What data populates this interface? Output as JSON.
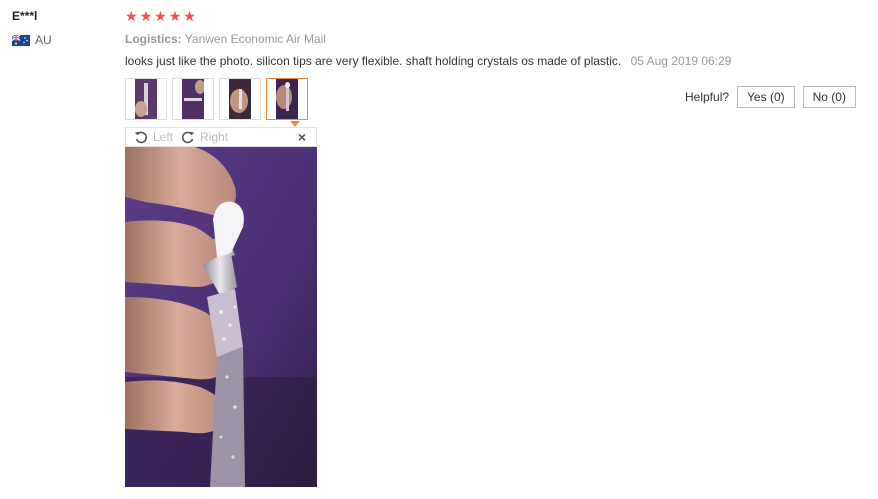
{
  "reviewer": {
    "name": "E***l",
    "country_code": "AU",
    "flag_icon": "australia-flag-icon"
  },
  "rating": {
    "stars": 5,
    "max": 5,
    "star_color": "#f44e4e"
  },
  "logistics": {
    "label": "Logistics:",
    "value": "Yanwen Economic Air Mail"
  },
  "review": {
    "text": "looks just like the photo. silicon tips are very flexible. shaft holding crystals os made of plastic.",
    "date": "05 Aug 2019 06:29"
  },
  "thumbnails": [
    {
      "name": "photo-thumbnail-1",
      "active": false
    },
    {
      "name": "photo-thumbnail-2",
      "active": false
    },
    {
      "name": "photo-thumbnail-3",
      "active": false
    },
    {
      "name": "photo-thumbnail-4",
      "active": true
    }
  ],
  "viewer": {
    "rotate_left_label": "Left",
    "rotate_right_label": "Right",
    "close_symbol": "×"
  },
  "helpful": {
    "label": "Helpful?",
    "yes_label": "Yes (0)",
    "no_label": "No (0)"
  },
  "colors": {
    "accent_border": "#f08a3a",
    "muted_text": "#999999"
  }
}
